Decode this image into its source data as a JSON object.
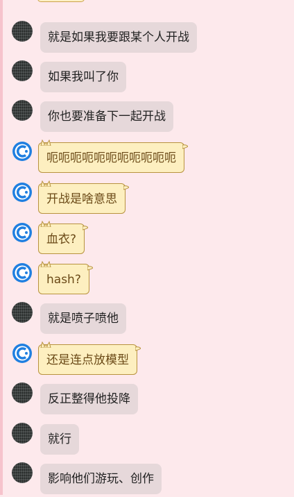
{
  "colors": {
    "page_background": "#fde9ec",
    "friend_bubble": "#e6d8da",
    "my_bubble": "#fdefc0",
    "my_bubble_border": "#b8923e",
    "my_avatar_accent": "#1f7fe0"
  },
  "messages": [
    {
      "sender": "friend",
      "text": "就是如果我要跟某个人开战"
    },
    {
      "sender": "friend",
      "text": "如果我叫了你"
    },
    {
      "sender": "friend",
      "text": "你也要准备下一起开战"
    },
    {
      "sender": "me",
      "text": "呃呃呃呃呃呃呃呃呃呃呃"
    },
    {
      "sender": "me",
      "text": "开战是啥意思"
    },
    {
      "sender": "me",
      "text": "血衣?"
    },
    {
      "sender": "me",
      "text": "hash?"
    },
    {
      "sender": "friend",
      "text": "就是喷子喷他"
    },
    {
      "sender": "me",
      "text": "还是连点放模型"
    },
    {
      "sender": "friend",
      "text": "反正整得他投降"
    },
    {
      "sender": "friend",
      "text": "就行"
    },
    {
      "sender": "friend",
      "text": "影响他们游玩、创作"
    }
  ],
  "icons": {
    "friend_avatar": "dark-textured-avatar-icon",
    "my_avatar": "blue-c-logo-avatar-icon",
    "bubble_decoration": "cat-ears-decoration-icon"
  }
}
